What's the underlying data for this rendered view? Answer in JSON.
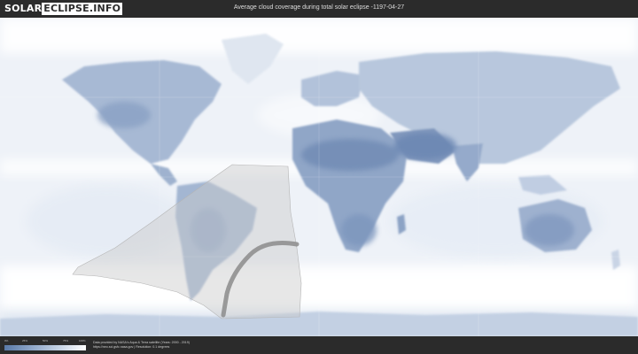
{
  "header": {
    "logo_left": "SOLAR",
    "logo_right": "ECLIPSE.INFO",
    "title": "Average cloud coverage during total solar eclipse -1197-04-27"
  },
  "map": {
    "ocean_color": "#f2f5fa",
    "cloud_dense_color": "#ffffff",
    "clear_sky_color": "#6f8db8",
    "land_clear_color": "#5b79a6",
    "eclipse_zone_color": "#d4d4d4",
    "eclipse_path_color": "#8c8c8c"
  },
  "legend": {
    "ticks": [
      "0%",
      "25%",
      "50%",
      "75%",
      "100%"
    ],
    "gradient": [
      "#5a7aa8",
      "#8ea6c8",
      "#c4d2e4",
      "#ffffff"
    ]
  },
  "credits": {
    "line1": "Data provided by NASA's Aqua & Terra satellite (Years: 2000 - 2019)",
    "line2": "https://neo.sci.gsfc.nasa.gov | Resolution: 0.1 degrees"
  }
}
